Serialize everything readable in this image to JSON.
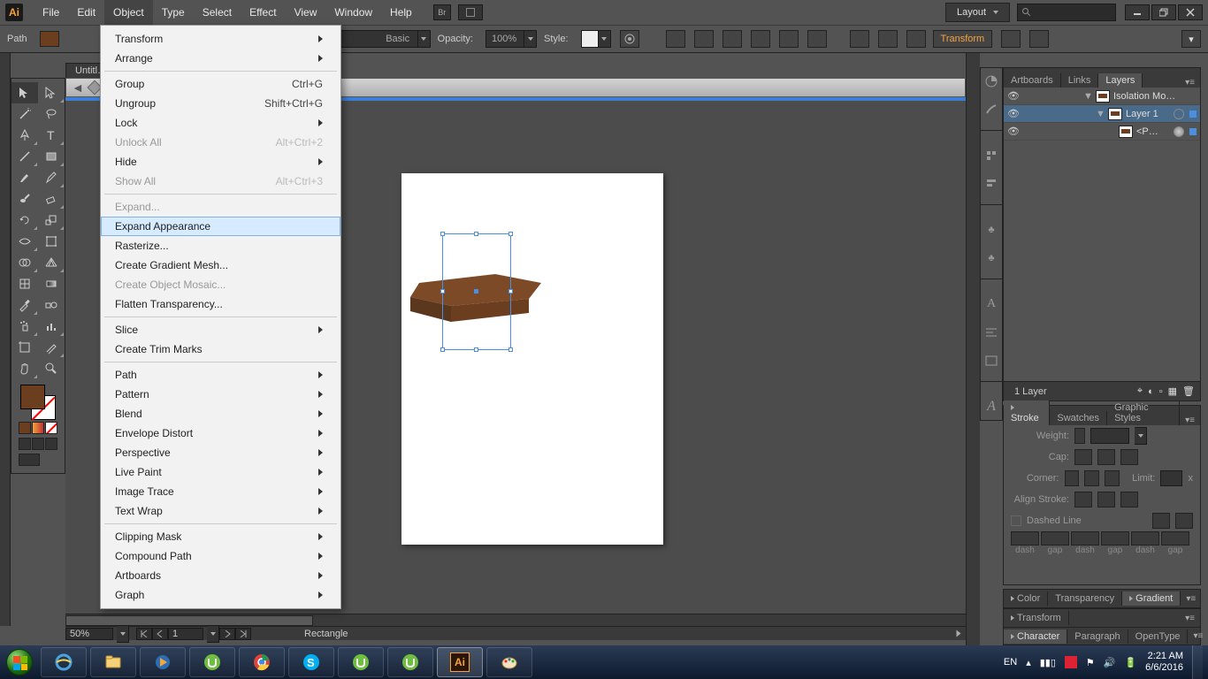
{
  "app": {
    "logo": "Ai"
  },
  "menubar": {
    "items": [
      "File",
      "Edit",
      "Object",
      "Type",
      "Select",
      "Effect",
      "View",
      "Window",
      "Help"
    ],
    "open_index": 2,
    "layout_label": "Layout"
  },
  "controlbar": {
    "selection_label": "Path",
    "stroke_weight": "",
    "brush_style": "Basic",
    "opacity_label": "Opacity:",
    "opacity_value": "100%",
    "style_label": "Style:",
    "transform_label": "Transform"
  },
  "doc_tab": {
    "title": "Untitl…"
  },
  "dropdown": {
    "sections": [
      [
        {
          "label": "Transform",
          "submenu": true
        },
        {
          "label": "Arrange",
          "submenu": true
        }
      ],
      [
        {
          "label": "Group",
          "shortcut": "Ctrl+G"
        },
        {
          "label": "Ungroup",
          "shortcut": "Shift+Ctrl+G"
        },
        {
          "label": "Lock",
          "submenu": true
        },
        {
          "label": "Unlock All",
          "shortcut": "Alt+Ctrl+2",
          "disabled": true
        },
        {
          "label": "Hide",
          "submenu": true
        },
        {
          "label": "Show All",
          "shortcut": "Alt+Ctrl+3",
          "disabled": true
        }
      ],
      [
        {
          "label": "Expand...",
          "disabled": true
        },
        {
          "label": "Expand Appearance",
          "hover": true
        },
        {
          "label": "Rasterize..."
        },
        {
          "label": "Create Gradient Mesh..."
        },
        {
          "label": "Create Object Mosaic...",
          "disabled": true
        },
        {
          "label": "Flatten Transparency..."
        }
      ],
      [
        {
          "label": "Slice",
          "submenu": true
        },
        {
          "label": "Create Trim Marks"
        }
      ],
      [
        {
          "label": "Path",
          "submenu": true
        },
        {
          "label": "Pattern",
          "submenu": true
        },
        {
          "label": "Blend",
          "submenu": true
        },
        {
          "label": "Envelope Distort",
          "submenu": true
        },
        {
          "label": "Perspective",
          "submenu": true
        },
        {
          "label": "Live Paint",
          "submenu": true
        },
        {
          "label": "Image Trace",
          "submenu": true
        },
        {
          "label": "Text Wrap",
          "submenu": true
        }
      ],
      [
        {
          "label": "Clipping Mask",
          "submenu": true
        },
        {
          "label": "Compound Path",
          "submenu": true
        },
        {
          "label": "Artboards",
          "submenu": true
        },
        {
          "label": "Graph",
          "submenu": true
        }
      ]
    ]
  },
  "layers_panel": {
    "tabs": [
      "Artboards",
      "Links",
      "Layers"
    ],
    "active_tab": 2,
    "rows": [
      {
        "indent": 0,
        "name": "Isolation Mo…",
        "toggle": "▼"
      },
      {
        "indent": 1,
        "name": "Layer 1",
        "toggle": "▼"
      },
      {
        "indent": 2,
        "name": "<P…",
        "toggle": ""
      }
    ],
    "footer": "1 Layer"
  },
  "stroke_panel": {
    "tabs": [
      "Stroke",
      "Swatches",
      "Graphic Styles"
    ],
    "active_tab": 0,
    "weight_label": "Weight:",
    "cap_label": "Cap:",
    "corner_label": "Corner:",
    "limit_label": "Limit:",
    "limit_x": "x",
    "align_label": "Align Stroke:",
    "dashed_label": "Dashed Line",
    "dash_labels": [
      "dash",
      "gap",
      "dash",
      "gap",
      "dash",
      "gap"
    ]
  },
  "color_tabs": [
    "Color",
    "Transparency",
    "Gradient"
  ],
  "color_tabs_active": 2,
  "transform_tabs": {
    "first": "Transform",
    "active": "Character",
    "tabs": [
      "Character",
      "Paragraph",
      "OpenType"
    ]
  },
  "status": {
    "zoom": "50%",
    "page": "1",
    "object": "Rectangle"
  },
  "taskbar": {
    "lang": "EN",
    "time": "2:21 AM",
    "date": "6/6/2016"
  },
  "colors": {
    "fill": "#6b3e1f",
    "accent": "#f7a23b",
    "sel": "#4a90e2"
  }
}
